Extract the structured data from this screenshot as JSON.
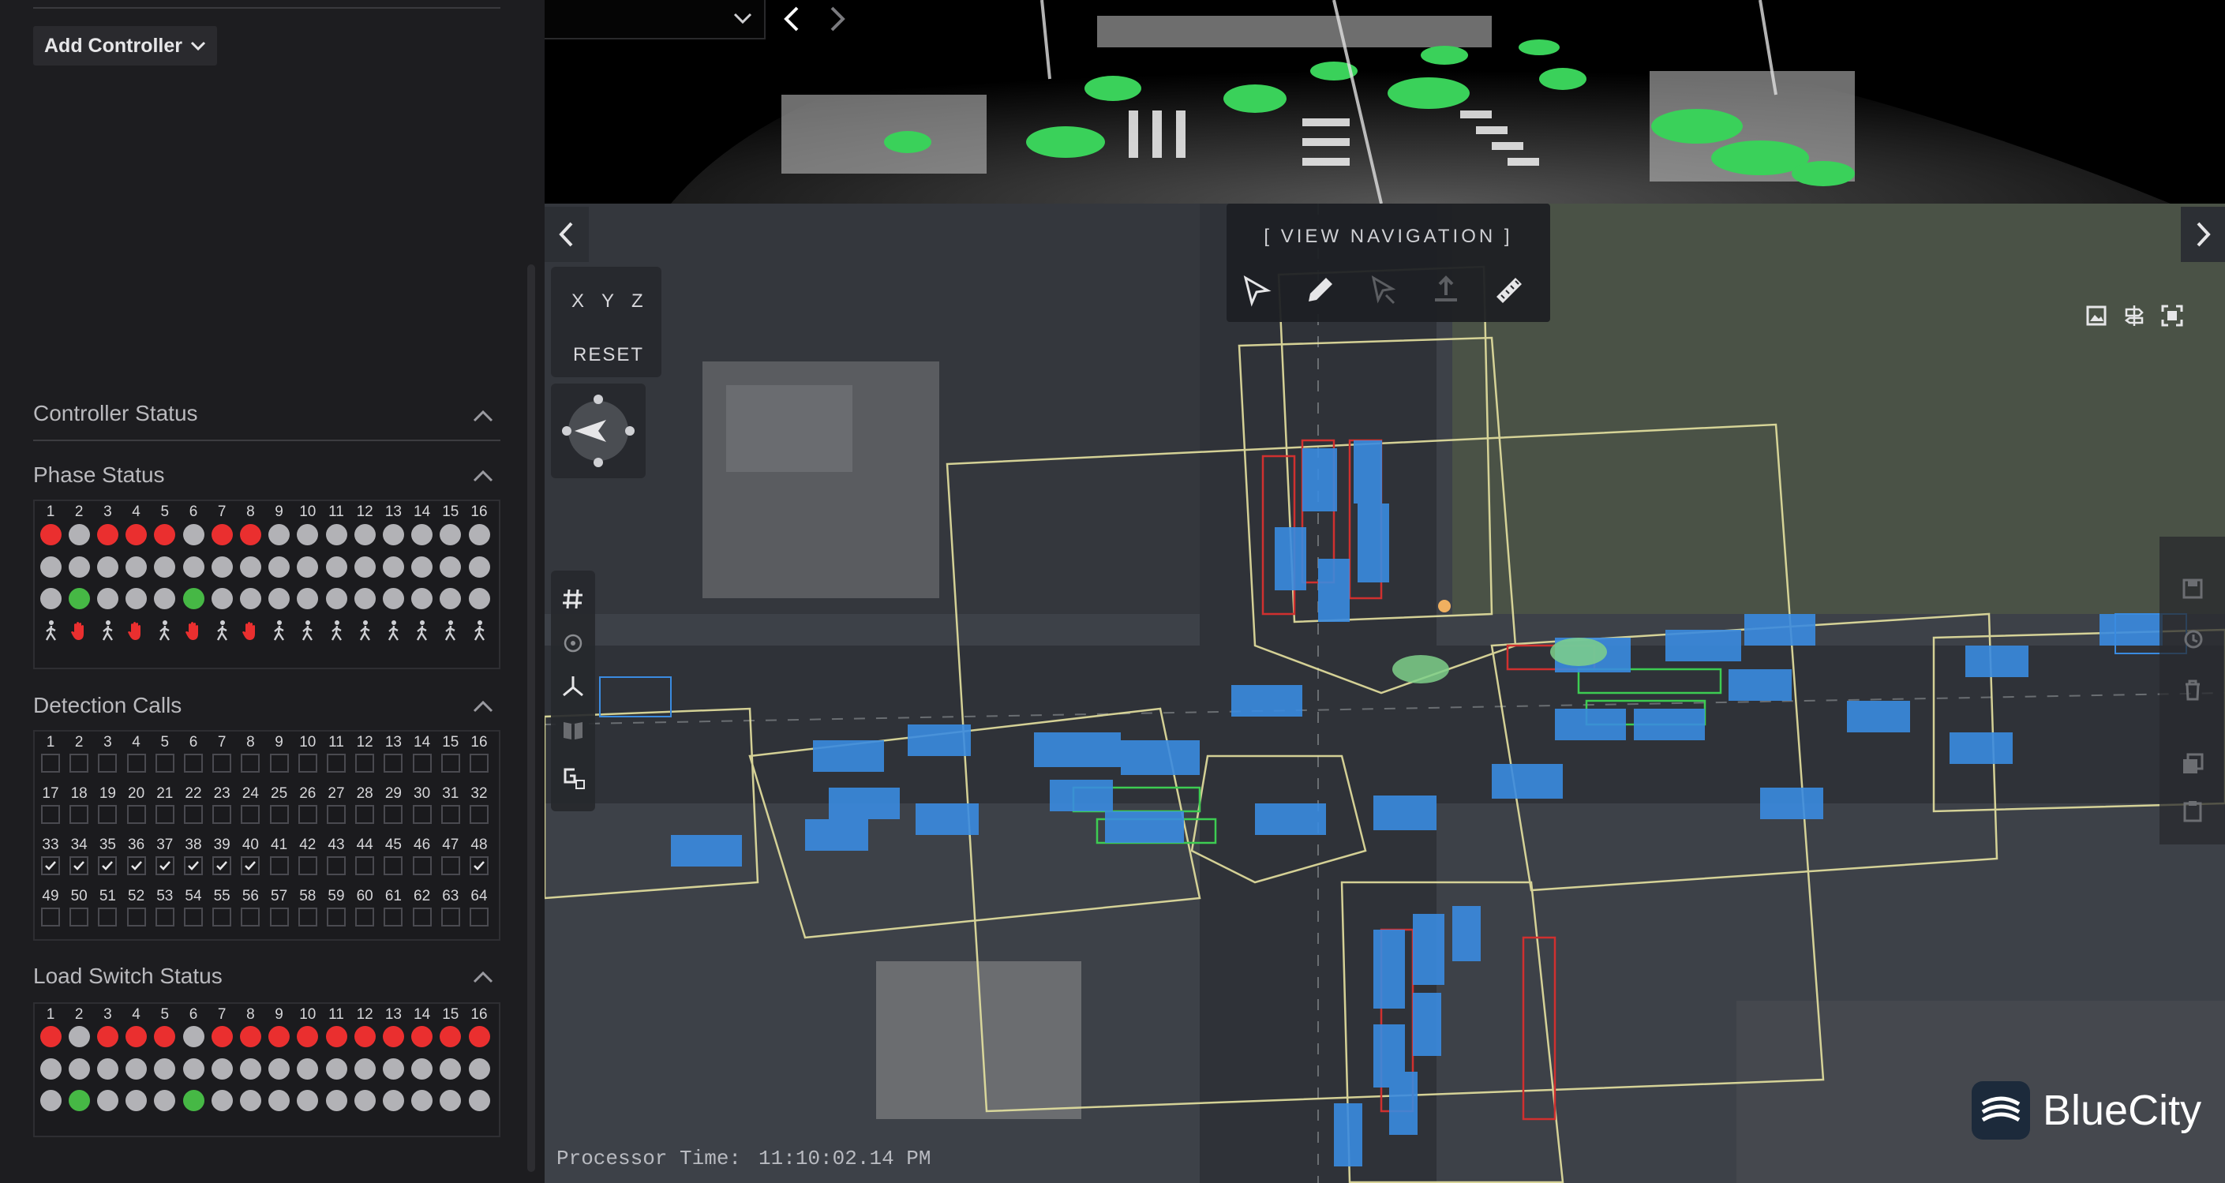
{
  "sidebar": {
    "add_controller_label": "Add Controller",
    "controller_status_title": "Controller Status",
    "phase_status": {
      "title": "Phase Status",
      "numbers": [
        "1",
        "2",
        "3",
        "4",
        "5",
        "6",
        "7",
        "8",
        "9",
        "10",
        "11",
        "12",
        "13",
        "14",
        "15",
        "16"
      ],
      "row1": [
        "red",
        "grey",
        "red",
        "red",
        "red",
        "grey",
        "red",
        "red",
        "grey",
        "grey",
        "grey",
        "grey",
        "grey",
        "grey",
        "grey",
        "grey"
      ],
      "row2": [
        "grey",
        "grey",
        "grey",
        "grey",
        "grey",
        "grey",
        "grey",
        "grey",
        "grey",
        "grey",
        "grey",
        "grey",
        "grey",
        "grey",
        "grey",
        "grey"
      ],
      "row3": [
        "grey",
        "green",
        "grey",
        "grey",
        "grey",
        "green",
        "grey",
        "grey",
        "grey",
        "grey",
        "grey",
        "grey",
        "grey",
        "grey",
        "grey",
        "grey"
      ],
      "pedestrian": [
        "walk",
        "dont-walk",
        "walk",
        "dont-walk",
        "walk",
        "dont-walk",
        "walk",
        "dont-walk",
        "walk",
        "walk",
        "walk",
        "walk",
        "walk",
        "walk",
        "walk",
        "walk"
      ]
    },
    "detection_calls": {
      "title": "Detection Calls",
      "rows": [
        {
          "numbers": [
            "1",
            "2",
            "3",
            "4",
            "5",
            "6",
            "7",
            "8",
            "9",
            "10",
            "11",
            "12",
            "13",
            "14",
            "15",
            "16"
          ],
          "checked": [
            false,
            false,
            false,
            false,
            false,
            false,
            false,
            false,
            false,
            false,
            false,
            false,
            false,
            false,
            false,
            false
          ]
        },
        {
          "numbers": [
            "17",
            "18",
            "19",
            "20",
            "21",
            "22",
            "23",
            "24",
            "25",
            "26",
            "27",
            "28",
            "29",
            "30",
            "31",
            "32"
          ],
          "checked": [
            false,
            false,
            false,
            false,
            false,
            false,
            false,
            false,
            false,
            false,
            false,
            false,
            false,
            false,
            false,
            false
          ]
        },
        {
          "numbers": [
            "33",
            "34",
            "35",
            "36",
            "37",
            "38",
            "39",
            "40",
            "41",
            "42",
            "43",
            "44",
            "45",
            "46",
            "47",
            "48"
          ],
          "checked": [
            true,
            true,
            true,
            true,
            true,
            true,
            true,
            true,
            false,
            false,
            false,
            false,
            false,
            false,
            false,
            true
          ]
        },
        {
          "numbers": [
            "49",
            "50",
            "51",
            "52",
            "53",
            "54",
            "55",
            "56",
            "57",
            "58",
            "59",
            "60",
            "61",
            "62",
            "63",
            "64"
          ],
          "checked": [
            false,
            false,
            false,
            false,
            false,
            false,
            false,
            false,
            false,
            false,
            false,
            false,
            false,
            false,
            false,
            false
          ]
        }
      ]
    },
    "load_switch_status": {
      "title": "Load Switch Status",
      "numbers": [
        "1",
        "2",
        "3",
        "4",
        "5",
        "6",
        "7",
        "8",
        "9",
        "10",
        "11",
        "12",
        "13",
        "14",
        "15",
        "16"
      ],
      "row1": [
        "red",
        "grey",
        "red",
        "red",
        "red",
        "grey",
        "red",
        "red",
        "red",
        "red",
        "red",
        "red",
        "red",
        "red",
        "red",
        "red"
      ],
      "row2": [
        "grey",
        "grey",
        "grey",
        "grey",
        "grey",
        "grey",
        "grey",
        "grey",
        "grey",
        "grey",
        "grey",
        "grey",
        "grey",
        "grey",
        "grey",
        "grey"
      ],
      "row3": [
        "grey",
        "green",
        "grey",
        "grey",
        "grey",
        "green",
        "grey",
        "grey",
        "grey",
        "grey",
        "grey",
        "grey",
        "grey",
        "grey",
        "grey",
        "grey"
      ]
    }
  },
  "viewer": {
    "axis_x": "X",
    "axis_y": "Y",
    "axis_z": "Z",
    "reset_label": "RESET",
    "view_navigation_title": "[ VIEW NAVIGATION ]",
    "processor_time_label": "Processor Time:",
    "processor_time_value": "11:10:02.14 PM",
    "brand_name": "BlueCity"
  },
  "colors": {
    "status_red": "#ea2f2f",
    "status_green": "#46b845",
    "status_grey": "#b2b2b6",
    "detection_blue": "#3a8be0",
    "zone_yellow": "#e6e2a0",
    "zone_red": "#d0302f",
    "zone_green": "#3dcc52"
  }
}
